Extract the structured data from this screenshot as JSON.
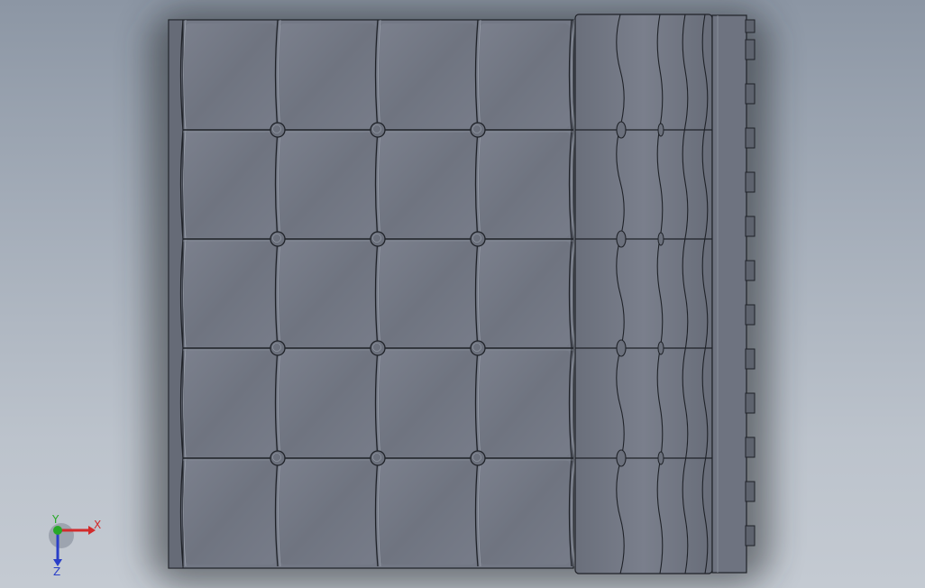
{
  "viewport": {
    "background_top": "#8c96a4",
    "background_bottom": "#c4cad2"
  },
  "model": {
    "type": "tufted-cushion",
    "tufted_rows": 5,
    "tufted_columns": 4,
    "side_panel_rows": 5,
    "edge_tab_count": 12,
    "colors": {
      "body": "#737885",
      "body_light": "#7f8491",
      "edge": "#1f2228",
      "button": "#6b707c",
      "shadow": "#2a2d33"
    }
  },
  "triad": {
    "x_label": "X",
    "y_label": "Y",
    "z_label": "Z",
    "x_color": "#d22b2b",
    "y_color": "#27a827",
    "z_color": "#2a3fc8"
  }
}
